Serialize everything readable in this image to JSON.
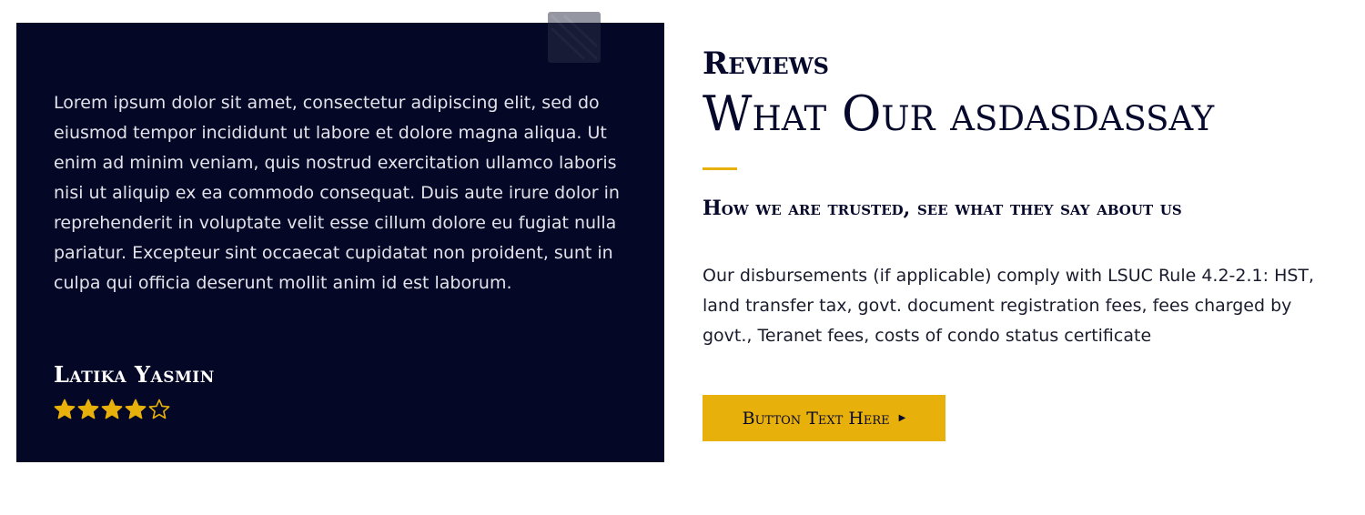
{
  "testimonial": {
    "quote_icon": "quote-icon",
    "body": "Lorem ipsum dolor sit amet, consectetur adipiscing elit, sed do eiusmod tempor incididunt ut labore et dolore magna aliqua. Ut enim ad minim veniam, quis nostrud exercitation ullamco laboris nisi ut aliquip ex ea commodo consequat. Duis aute irure dolor in reprehenderit in voluptate velit esse cillum dolore eu fugiat nulla pariatur. Excepteur sint occaecat cupidatat non proident, sunt in culpa qui officia deserunt mollit anim id est laborum.",
    "reviewer_name": "Latika Yasmin",
    "rating": 4,
    "rating_max": 5,
    "star_icon": "star-icon"
  },
  "section": {
    "eyebrow": "Reviews",
    "title": "What Our asdasdassay",
    "subtitle": "How we are trusted, see what they say about us",
    "description": "Our disbursements (if applicable) comply with LSUC Rule 4.2-2.1: HST, land transfer tax, govt. document registration fees, fees charged by govt., Teranet fees, costs of condo status certificate",
    "button_label": "Button Text Here",
    "button_icon": "play-arrow-icon"
  },
  "colors": {
    "card_background": "#040725",
    "accent": "#e8b00b",
    "heading": "#06092b",
    "page_background": "#ffffff"
  }
}
